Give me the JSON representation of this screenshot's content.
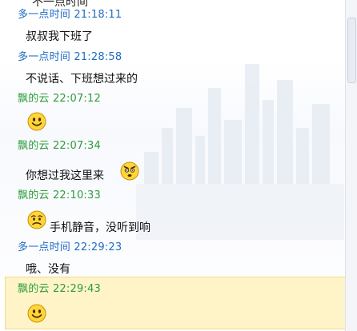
{
  "chat": {
    "clipped_text": "不一点时间",
    "messages": [
      {
        "sender": "多一点时间",
        "time": "21:18:11",
        "text": "叔叔我下班了"
      },
      {
        "sender": "多一点时间",
        "time": "21:28:58",
        "text": "不说话、下班想过来的"
      },
      {
        "sender": "飘的云",
        "time": "22:07:12",
        "text": ""
      },
      {
        "sender": "飘的云",
        "time": "22:07:34",
        "text": "你想过我这里来"
      },
      {
        "sender": "飘的云",
        "time": "22:10:33",
        "text": "手机静音，没听到响"
      },
      {
        "sender": "多一点时间",
        "time": "22:29:23",
        "text": "哦、没有"
      },
      {
        "sender": "飘的云",
        "time": "22:29:43",
        "text": ""
      }
    ]
  },
  "colors": {
    "self_sender": "#1f6cc4",
    "other_sender": "#2e9d3a",
    "selected_bg": "#fff4c8"
  },
  "icons": [
    "smiley-icon",
    "angry-face-icon",
    "worried-face-icon"
  ]
}
